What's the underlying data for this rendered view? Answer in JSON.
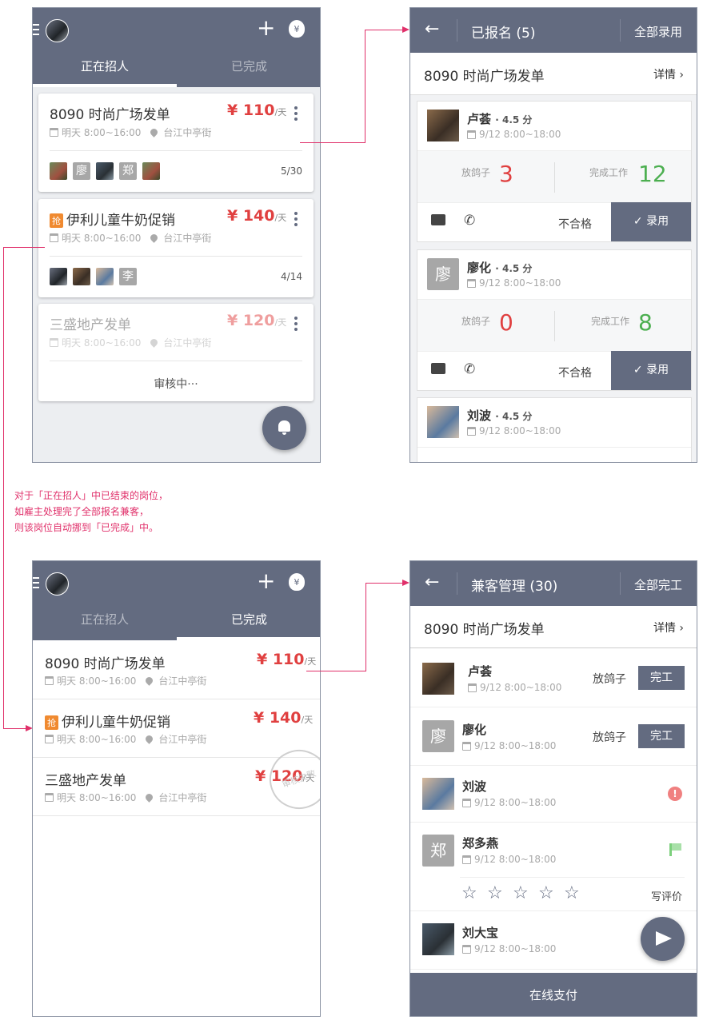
{
  "s1": {
    "tabs": [
      "正在招人",
      "已完成"
    ],
    "jobs": [
      {
        "title": "8090 时尚广场发单",
        "price": "¥ 110",
        "unit": "/天",
        "date": "明天 8:00~16:00",
        "location": "台江中亭街",
        "count": "5/30",
        "avatars": [
          "廖",
          "郑"
        ]
      },
      {
        "tag": "抢",
        "title": "伊利儿童牛奶促销",
        "price": "¥ 140",
        "unit": "/天",
        "date": "明天 8:00~16:00",
        "location": "台江中亭街",
        "count": "4/14",
        "avatars": [
          "李"
        ]
      },
      {
        "title": "三盛地产发单",
        "price": "¥ 120",
        "unit": "/天",
        "date": "明天 8:00~16:00",
        "location": "台江中亭街",
        "status": "审核中···"
      }
    ]
  },
  "s2": {
    "title": "已报名 (5)",
    "action": "全部录用",
    "job": "8090 时尚广场发单",
    "detail": "详情",
    "applicants": [
      {
        "name": "卢荟",
        "rating": "· 4.5 分",
        "date": "9/12 8:00~18:00",
        "flake_label": "放鸽子",
        "flake": "3",
        "done_label": "完成工作",
        "done": "12",
        "reject": "不合格",
        "hire": "录用"
      },
      {
        "name": "廖化",
        "avatar": "廖",
        "rating": "· 4.5 分",
        "date": "9/12 8:00~18:00",
        "flake_label": "放鸽子",
        "flake": "0",
        "done_label": "完成工作",
        "done": "8",
        "reject": "不合格",
        "hire": "录用"
      },
      {
        "name": "刘波",
        "rating": "· 4.5 分",
        "date": "9/12 8:00~18:00"
      }
    ]
  },
  "annotation": [
    "对于「正在招人」中已结束的岗位，",
    "如雇主处理完了全部报名兼客，",
    "则该岗位自动挪到「已完成」中。"
  ],
  "s3": {
    "tabs": [
      "正在招人",
      "已完成"
    ],
    "jobs": [
      {
        "title": "8090 时尚广场发单",
        "price": "¥ 110",
        "unit": "/天",
        "date": "明天 8:00~16:00",
        "location": "台江中亭街"
      },
      {
        "tag": "抢",
        "title": "伊利儿童牛奶促销",
        "price": "¥ 140",
        "unit": "/天",
        "date": "明天 8:00~16:00",
        "location": "台江中亭街"
      },
      {
        "title": "三盛地产发单",
        "price": "¥ 120",
        "unit": "/天",
        "date": "明天 8:00~16:00",
        "location": "台江中亭街",
        "stamp": "审核失败"
      }
    ]
  },
  "s4": {
    "title": "兼客管理 (30)",
    "action": "全部完工",
    "job": "8090 时尚广场发单",
    "detail": "详情",
    "workers": [
      {
        "name": "卢荟",
        "date": "9/12 8:00~18:00",
        "flake": "放鸽子",
        "finish": "完工"
      },
      {
        "name": "廖化",
        "avatar": "廖",
        "date": "9/12 8:00~18:00",
        "flake": "放鸽子",
        "finish": "完工"
      },
      {
        "name": "刘波",
        "date": "9/12 8:00~18:00"
      },
      {
        "name": "郑多燕",
        "avatar": "郑",
        "date": "9/12 8:00~18:00",
        "review": "写评价"
      },
      {
        "name": "刘大宝",
        "date": "9/12 8:00~18:00"
      }
    ],
    "pay": "在线支付"
  },
  "colors": {
    "header": "#636b80",
    "price": "#e04040",
    "green": "#4caf50",
    "accent": "#e0306a",
    "tag": "#f08a30"
  }
}
